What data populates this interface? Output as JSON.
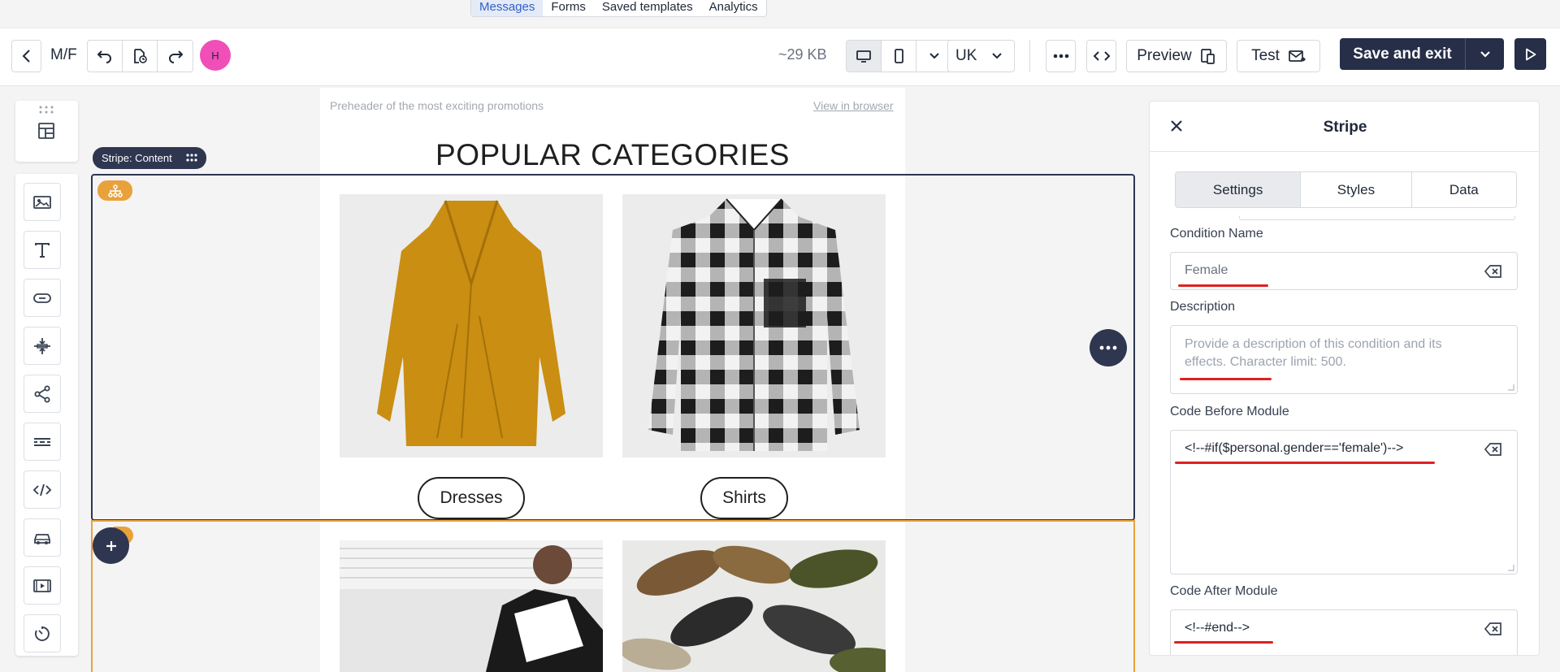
{
  "nav": {
    "tabs": [
      "Messages",
      "Forms",
      "Saved templates",
      "Analytics"
    ]
  },
  "toolbar": {
    "template_name": "M/F",
    "avatar_initial": "H",
    "size": "~29 KB",
    "locale": "UK",
    "preview_label": "Preview",
    "test_label": "Test",
    "save_label": "Save and exit"
  },
  "canvas": {
    "preheader": "Preheader of the most exciting promotions",
    "view_in_browser": "View in browser",
    "heading": "POPULAR CATEGORIES",
    "stripe_label": "Stripe: Content",
    "categories": [
      "Dresses",
      "Shirts"
    ]
  },
  "panel": {
    "title": "Stripe",
    "tabs": [
      "Settings",
      "Styles",
      "Data"
    ],
    "condition_name_label": "Condition Name",
    "condition_name_value": "Female",
    "description_label": "Description",
    "description_placeholder": "Provide a description of this condition and its effects. Character limit: 500.",
    "code_before_label": "Code Before Module",
    "code_before_value": "<!--#if($personal.gender=='female')-->",
    "code_after_label": "Code After Module",
    "code_after_value": "<!--#end-->"
  },
  "colors": {
    "accent_dark": "#262e48",
    "condition_orange": "#e9a23b",
    "avatar_pink": "#f04fb8",
    "highlight_red": "#e02020"
  }
}
